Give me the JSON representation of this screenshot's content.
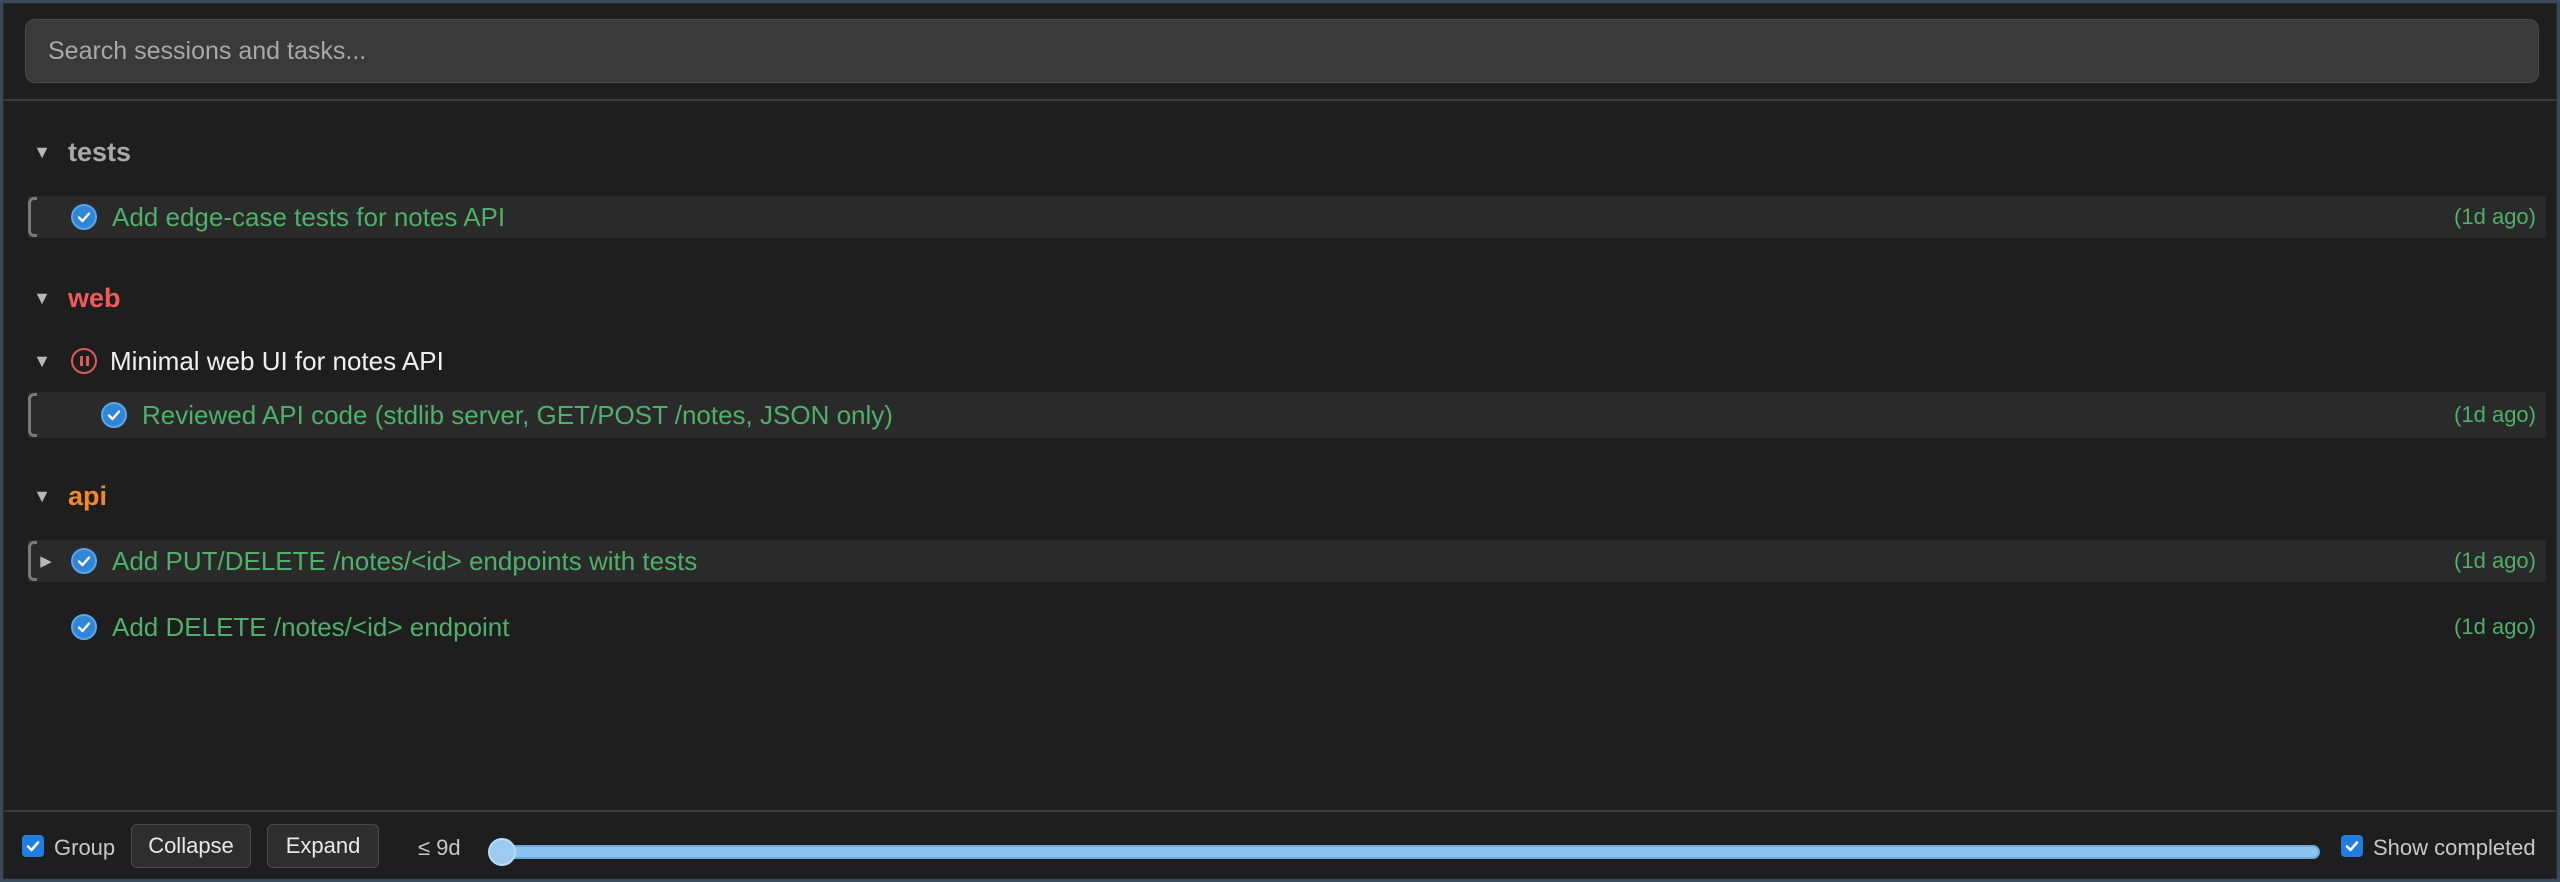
{
  "search": {
    "placeholder": "Search sessions and tasks..."
  },
  "groups": [
    {
      "label": "tests",
      "color": "#a9a9a9"
    },
    {
      "label": "web",
      "color": "#f05a5a"
    },
    {
      "label": "api",
      "color": "#f08a2a"
    }
  ],
  "tasks": {
    "tests_1": {
      "text": "Add edge-case tests for notes API",
      "time": "(1d ago)"
    },
    "web_session": {
      "text": "Minimal web UI for notes API"
    },
    "web_1": {
      "text": "Reviewed API code (stdlib server, GET/POST /notes, JSON only)",
      "time": "(1d ago)"
    },
    "api_1": {
      "text": "Add PUT/DELETE /notes/<id> endpoints with tests",
      "time": "(1d ago)"
    },
    "api_2": {
      "text": "Add DELETE /notes/<id> endpoint",
      "time": "(1d ago)"
    }
  },
  "footer": {
    "group_label": "Group",
    "collapse_label": "Collapse",
    "expand_label": "Expand",
    "age_label": "≤ 9d",
    "show_completed_label": "Show completed",
    "age_slider_position": 0
  },
  "colors": {
    "done_green": "#4fb06a",
    "check_blue": "#2f86d6",
    "accent": "#1f7ee0"
  }
}
